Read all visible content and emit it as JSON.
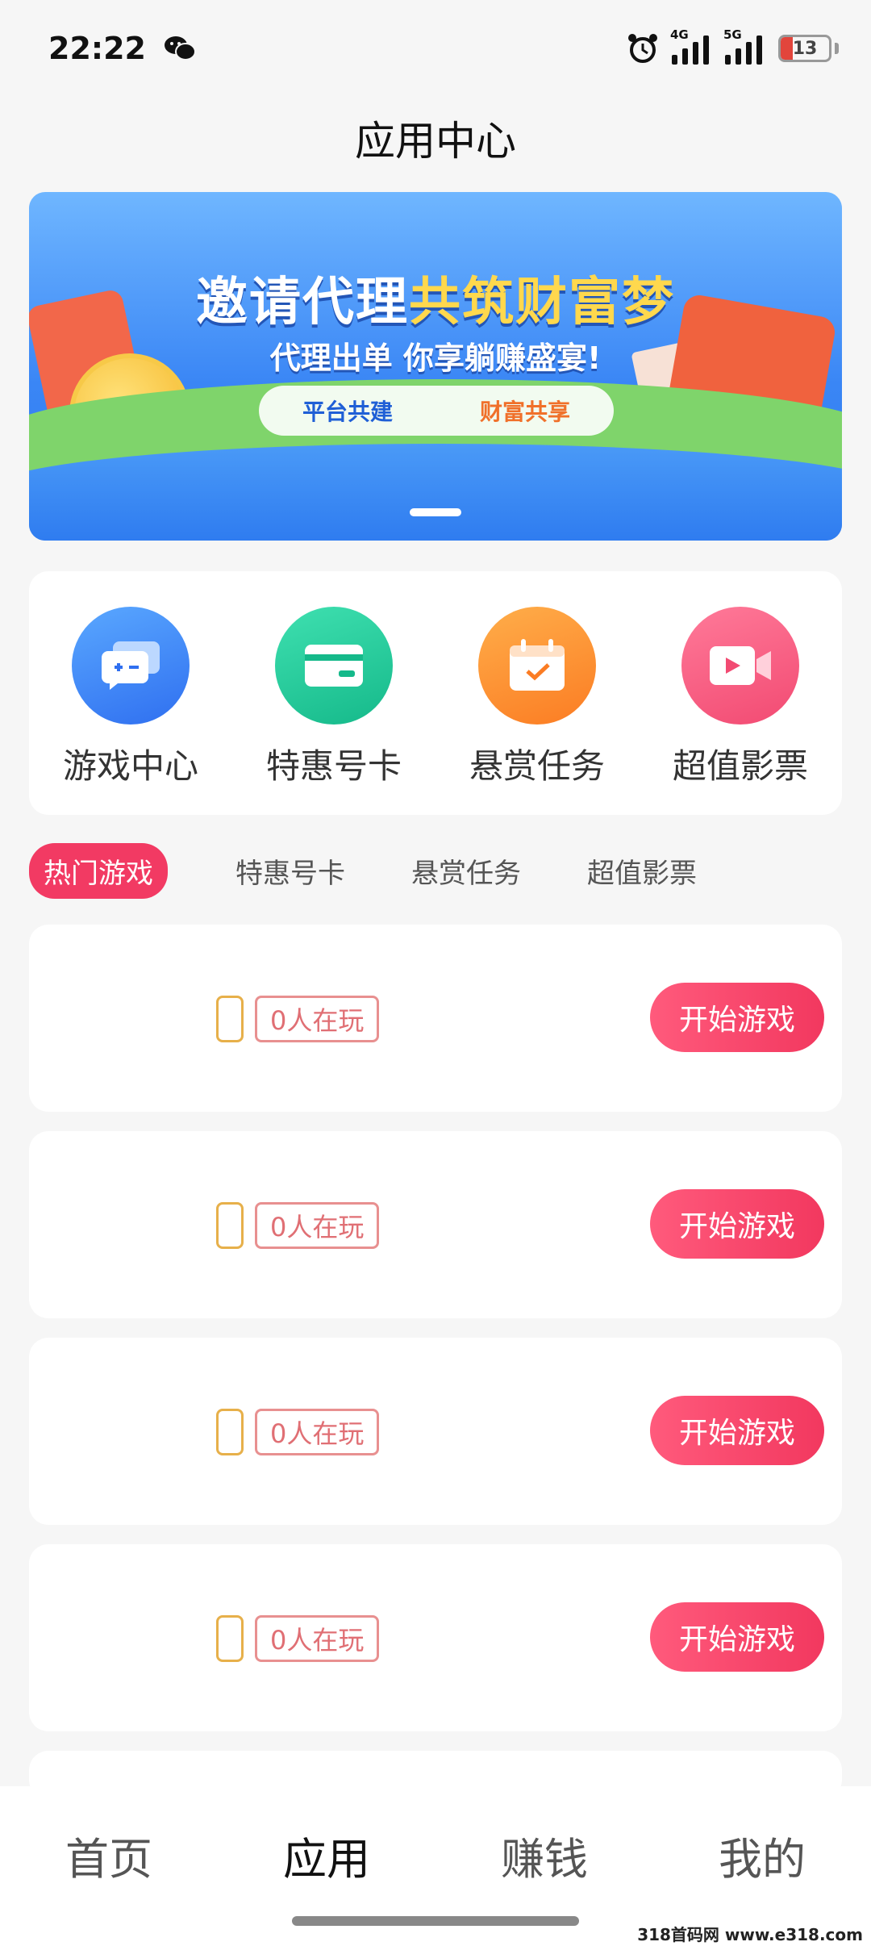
{
  "status_bar": {
    "time": "22:22",
    "network_1": "4G",
    "network_2": "5G",
    "battery": "13"
  },
  "page_title": "应用中心",
  "banner": {
    "title_part1": "邀请代理",
    "title_part2": "共筑财富梦",
    "subtitle": "代理出单 你享躺赚盛宴!",
    "pill_left": "平台共建",
    "pill_right": "财富共享"
  },
  "quick_items": [
    {
      "label": "游戏中心",
      "icon": "game-chat-icon"
    },
    {
      "label": "特惠号卡",
      "icon": "card-icon"
    },
    {
      "label": "悬赏任务",
      "icon": "calendar-check-icon"
    },
    {
      "label": "超值影票",
      "icon": "video-play-icon"
    }
  ],
  "tabs": [
    "热门游戏",
    "特惠号卡",
    "悬赏任务",
    "超值影票"
  ],
  "games": [
    {
      "players": "0人在玩",
      "button": "开始游戏"
    },
    {
      "players": "0人在玩",
      "button": "开始游戏"
    },
    {
      "players": "0人在玩",
      "button": "开始游戏"
    },
    {
      "players": "0人在玩",
      "button": "开始游戏"
    }
  ],
  "bottom_nav": [
    "首页",
    "应用",
    "赚钱",
    "我的"
  ],
  "watermark": "318首码网 www.e318.com",
  "colors": {
    "accent": "#f23a63",
    "banner_blue": "#3a86f5",
    "badge_text": "#e06f74"
  }
}
